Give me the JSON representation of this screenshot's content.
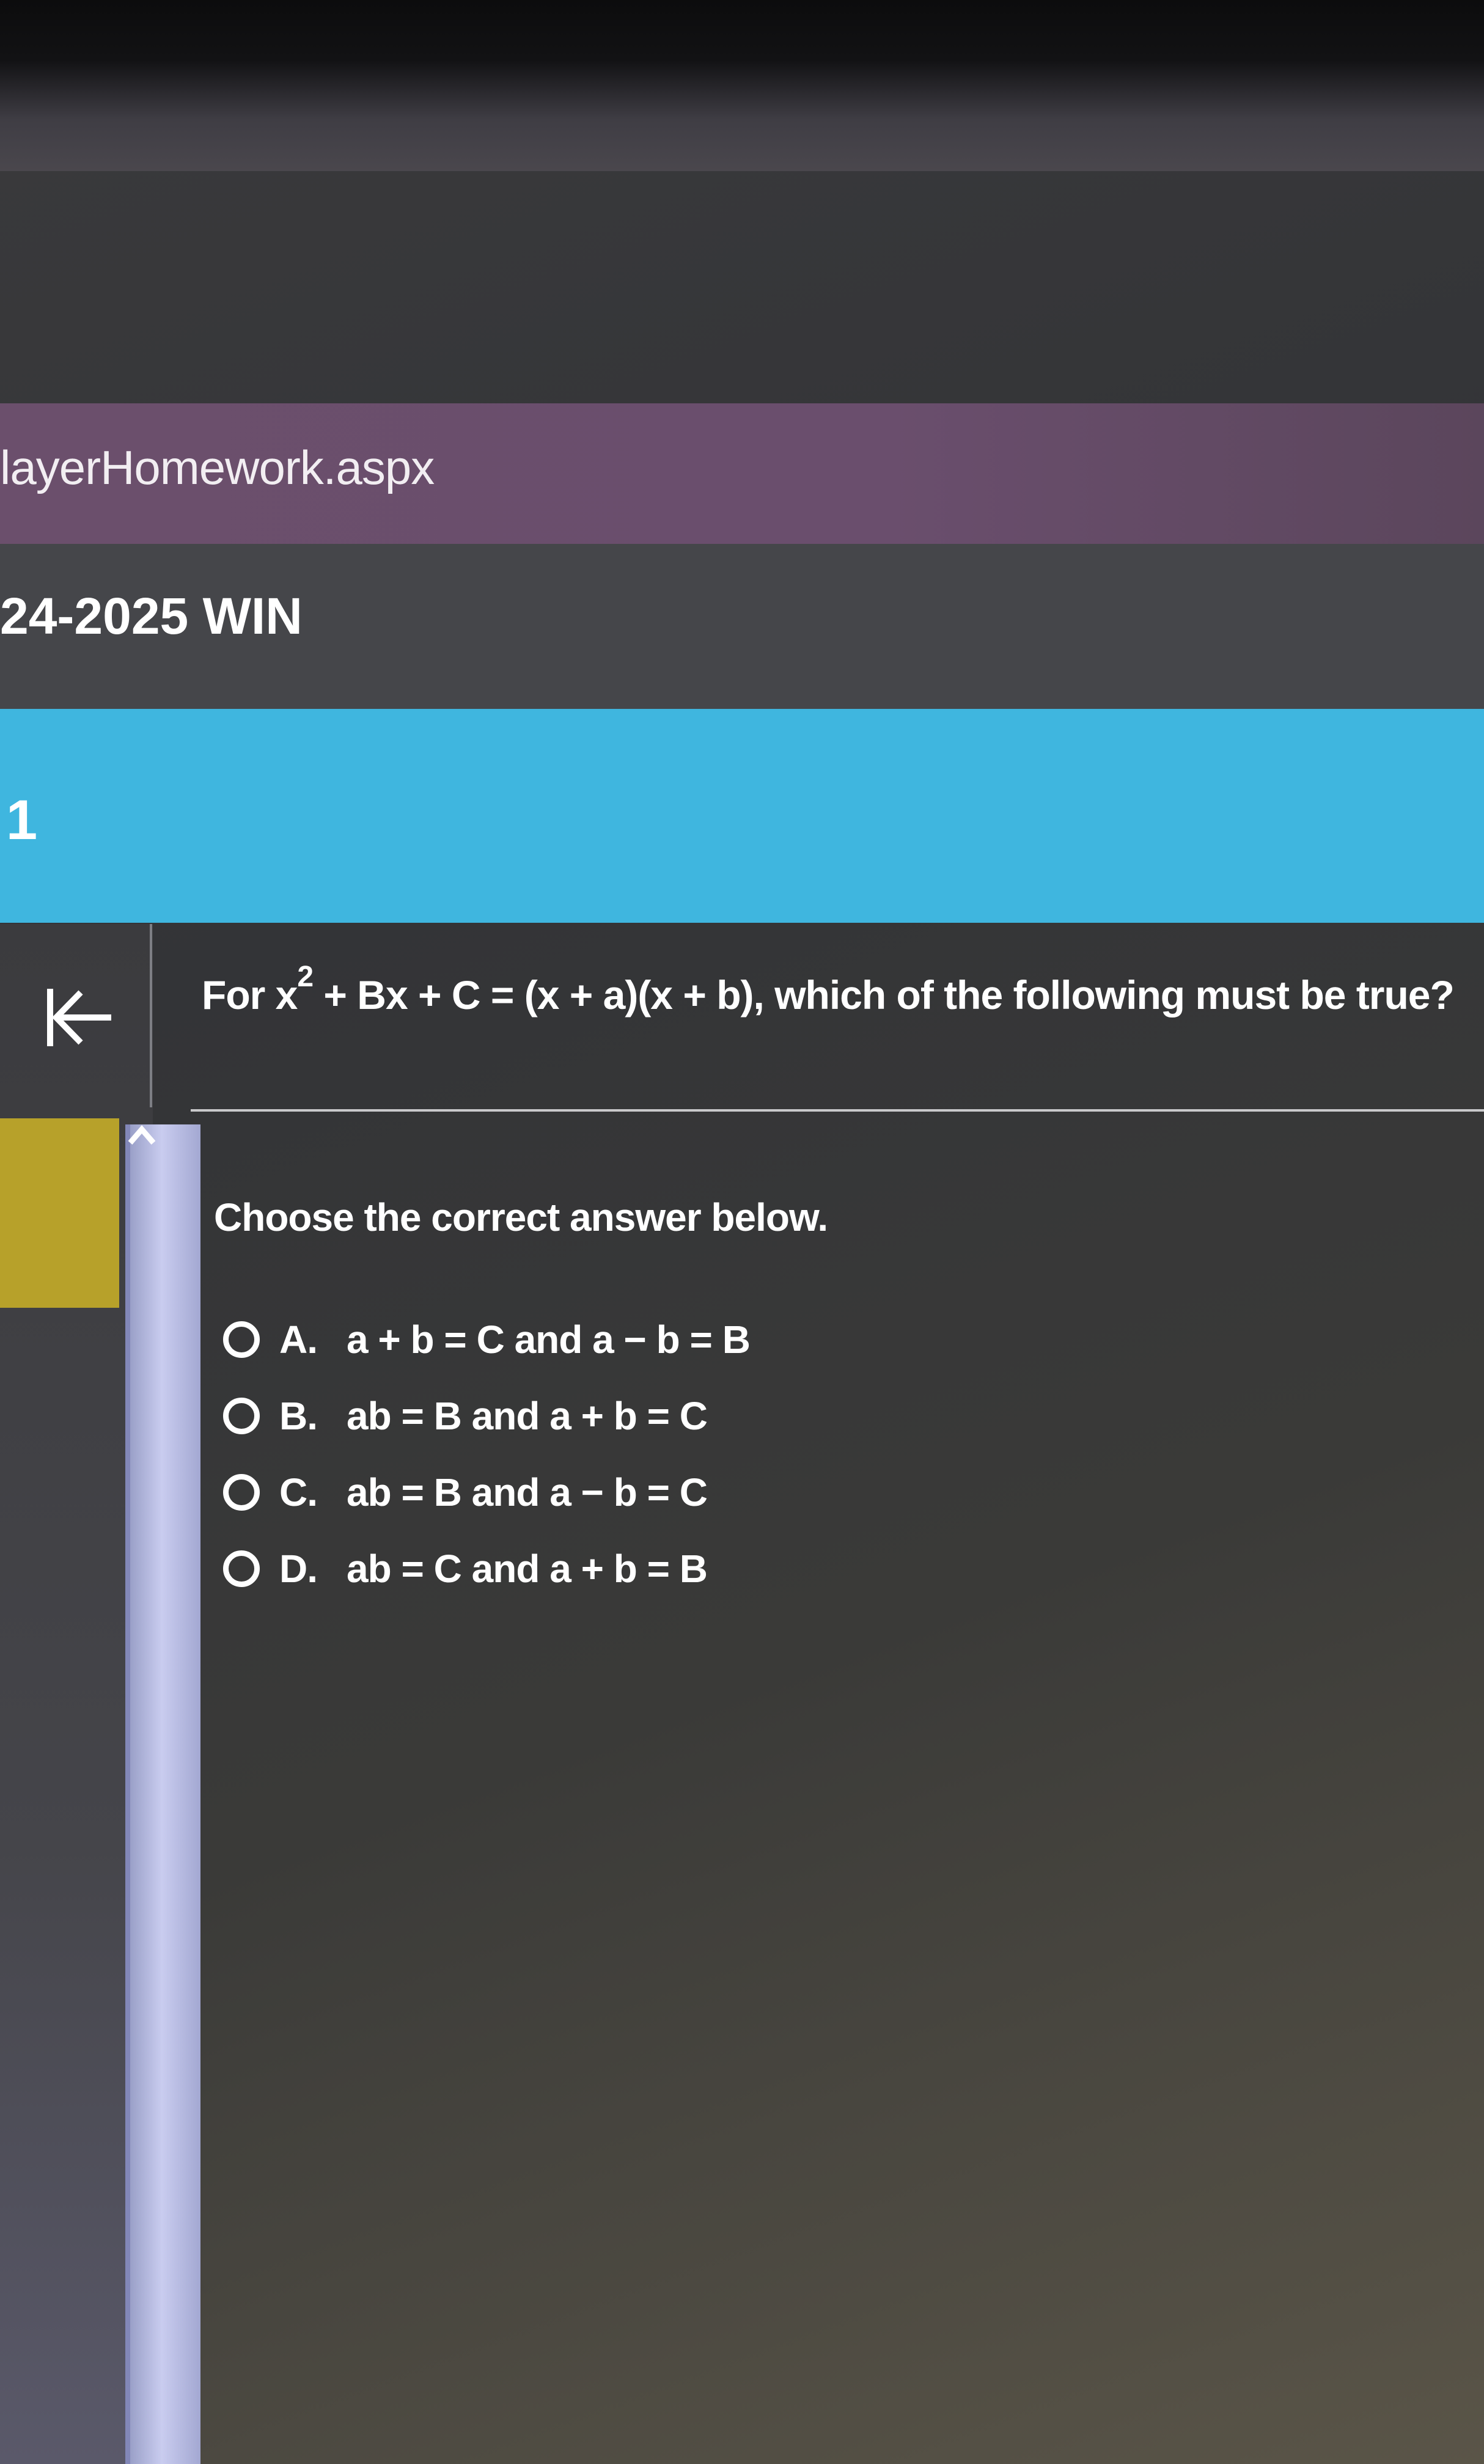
{
  "browser": {
    "url_fragment": "layerHomework.aspx"
  },
  "course": {
    "title_fragment": "24-2025 WIN"
  },
  "header": {
    "number": "1"
  },
  "question": {
    "prefix": "For x",
    "exponent": "2",
    "rest": " + Bx + C = (x + a)(x + b), which of the following must be true?"
  },
  "instruction": "Choose the correct answer below.",
  "options": [
    {
      "letter": "A.",
      "text": "a + b = C and a − b = B"
    },
    {
      "letter": "B.",
      "text": "ab = B and a + b = C"
    },
    {
      "letter": "C.",
      "text": "ab = B and a − b = C"
    },
    {
      "letter": "D.",
      "text": "ab = C and a + b = B"
    }
  ],
  "colors": {
    "url_bar": "#6b4f6c",
    "header_blue": "#3fb6df",
    "sidebar_yellow": "#b7a12a",
    "scrollbar": "#c9ccef"
  },
  "icons": {
    "collapse": "collapse-left-icon",
    "scroll_up": "chevron-up-icon"
  }
}
